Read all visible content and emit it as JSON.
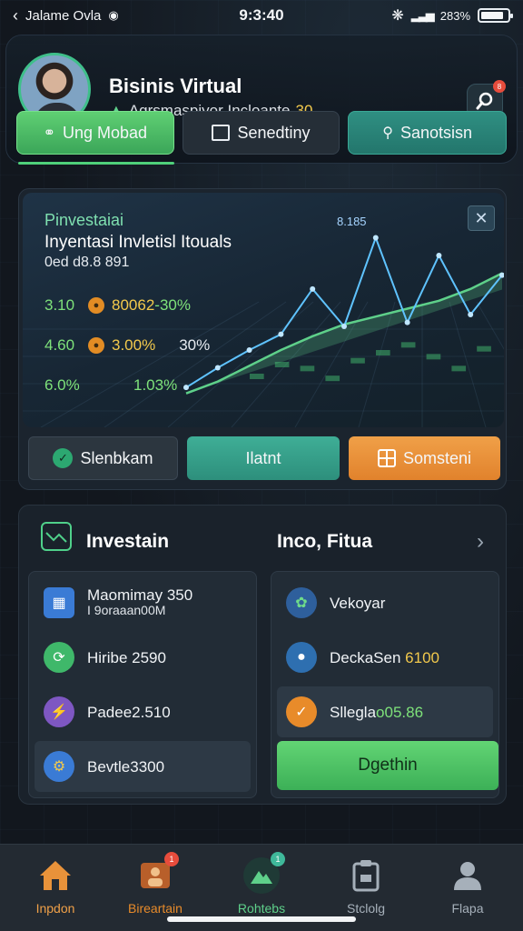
{
  "status_bar": {
    "carrier": "Jalame Ovla",
    "time": "9:3:40",
    "battery_text": "283%",
    "battery_level": 0.85
  },
  "header": {
    "title": "Bisinis Virtual",
    "subtitle": "Agrsmaspiyor Incloante",
    "subtitle_num": "30",
    "notification_badge": "8"
  },
  "tabs": [
    {
      "label": "Ung Mobad",
      "icon": "chat-bubble-icon"
    },
    {
      "label": "Senedtiny",
      "icon": "document-icon"
    },
    {
      "label": "Sanotsisn",
      "icon": "person-icon"
    }
  ],
  "chart_card": {
    "title_1": "Pinvestaiai",
    "title_2": "Inyentasi Invletisl Itouals",
    "title_3": "0ed d8.8 891",
    "peak_label": "8.185",
    "stats": [
      {
        "value": "3.10",
        "amount": "80062",
        "pct": "-30%"
      },
      {
        "value": "4.60",
        "amount": "3.00%",
        "pct": "30%"
      },
      {
        "value": "6.0%",
        "amount": "1.03%",
        "pct": ""
      }
    ],
    "buttons": [
      {
        "label": "Slenbkam"
      },
      {
        "label": "Ilatnt"
      },
      {
        "label": "Somsteni"
      }
    ]
  },
  "chart_data": {
    "type": "line",
    "x": [
      0,
      1,
      2,
      3,
      4,
      5,
      6,
      7,
      8,
      9,
      10
    ],
    "series": [
      {
        "values": [
          0.5,
          1.5,
          2.4,
          3.2,
          5.5,
          3.6,
          8.1,
          3.8,
          7.2,
          4.2,
          6.2
        ]
      },
      {
        "values": [
          0.2,
          0.8,
          1.6,
          2.4,
          3.1,
          3.7,
          4.1,
          4.5,
          4.9,
          5.5,
          6.3
        ]
      }
    ],
    "bars": [
      1.2,
      1.8,
      1.6,
      1.1,
      2.0,
      2.4,
      2.8,
      2.2,
      1.6,
      2.6
    ],
    "ylim": [
      0,
      9
    ],
    "colors": {
      "primary": "#5fc3ff",
      "secondary": "#5ed08a",
      "bars": "#3fae6a"
    }
  },
  "investment": {
    "title": "Investain",
    "title_2": "Inco, Fitua",
    "left_items": [
      {
        "label": "Maomimay 350",
        "sub": "I 9oraaan00M",
        "icon": "calculator-icon",
        "color": "#3a7bd5"
      },
      {
        "label": "Hiribe 2590",
        "sub": "",
        "icon": "refresh-icon",
        "color": "#3fb86a"
      },
      {
        "label": "Padee2.510",
        "sub": "",
        "icon": "lightning-icon",
        "color": "#7e57c2"
      },
      {
        "label": "Bevtle3300",
        "sub": "",
        "icon": "gear-icon",
        "color": "#3a7bd5"
      }
    ],
    "right_items": [
      {
        "label": "Vekoyar",
        "accent": "",
        "icon": "leaf-icon",
        "color": "#2e5f9c"
      },
      {
        "label": "DeckaSen",
        "accent": "6100",
        "icon": "apple-icon",
        "color": "#2e6fb0"
      },
      {
        "label": "Sllegla",
        "accent": "o05.86",
        "icon": "check-icon",
        "color": "#e88b2a"
      }
    ],
    "cta_label": "Dgethin"
  },
  "bottom_nav": [
    {
      "label": "Inpdon",
      "icon": "home-icon",
      "color": "#f0a048"
    },
    {
      "label": "Bireartain",
      "icon": "person-board-icon",
      "color": "#e88b2a",
      "badge": "1"
    },
    {
      "label": "Rohtebs",
      "icon": "mountain-icon",
      "color": "#5ed08a",
      "badge": "1"
    },
    {
      "label": "Stclolg",
      "icon": "clipboard-icon",
      "color": "#a6b0ba"
    },
    {
      "label": "Flapa",
      "icon": "profile-icon",
      "color": "#a6b0ba"
    }
  ]
}
